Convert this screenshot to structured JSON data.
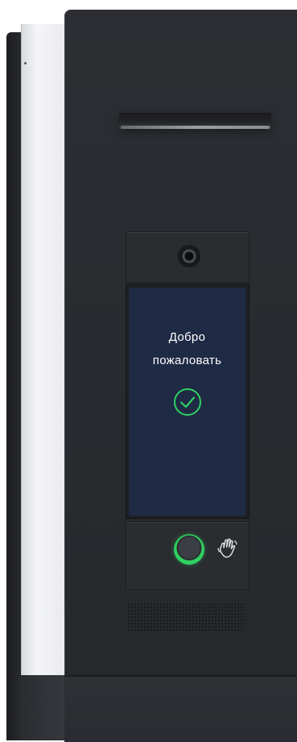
{
  "screen": {
    "greeting_line1": "Добро",
    "greeting_line2": "пожаловать",
    "status_icon": "check-circle-icon"
  },
  "reader": {
    "button_ring_color": "#2fd160",
    "gesture_icon": "hand-wave-icon"
  },
  "colors": {
    "housing": "#2a2c30",
    "screen_background": "#1f2a45",
    "accent_green": "#2fd160"
  }
}
